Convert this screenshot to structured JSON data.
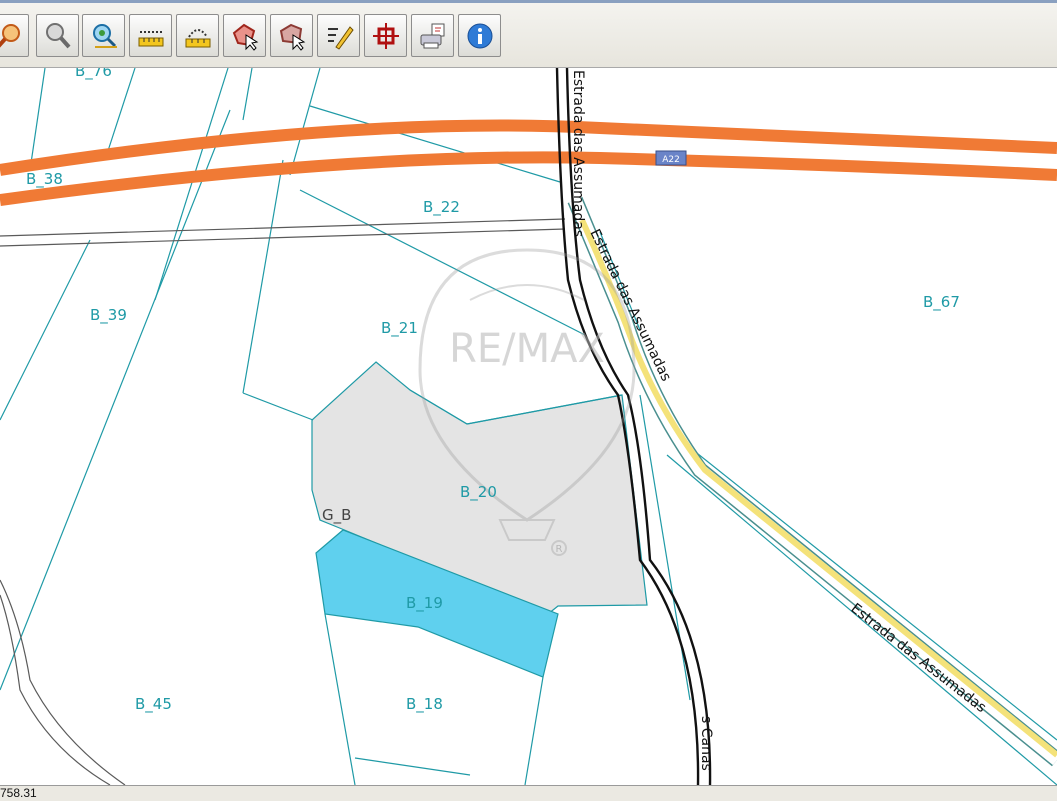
{
  "toolbar": {
    "buttons": [
      {
        "icon": "zoom-in-icon"
      },
      {
        "icon": "zoom-out-icon"
      },
      {
        "icon": "zoom-extent-icon"
      },
      {
        "icon": "measure-distance-icon"
      },
      {
        "icon": "measure-area-icon"
      },
      {
        "icon": "select-parcel-icon"
      },
      {
        "icon": "select-feature-icon"
      },
      {
        "icon": "edit-icon"
      },
      {
        "icon": "target-icon"
      },
      {
        "icon": "print-icon"
      },
      {
        "icon": "info-icon"
      }
    ]
  },
  "map": {
    "parcels": [
      "B_76",
      "B_38",
      "B_22",
      "B_39",
      "B_21",
      "B_67",
      "B_20",
      "G_B",
      "B_19",
      "B_45",
      "B_18"
    ],
    "roads": {
      "highway_badge": "A22",
      "road_top": "Estrada das Assumadas",
      "road_yellow_1": "Estrada das Assumadas",
      "road_yellow_2": "Estrada das Assumadas",
      "road_bottom": "s Canas"
    },
    "watermark": {
      "brand": "RE/MAX",
      "mark": "R"
    },
    "colors": {
      "highway": "#f07a35",
      "parcel_line": "#1f9aa6",
      "selected_parcel": "#5fd0ee",
      "neighbor_parcel": "#e4e4e4",
      "local_road": "#f4e27a"
    }
  },
  "status": {
    "coordinate": "758.31"
  }
}
